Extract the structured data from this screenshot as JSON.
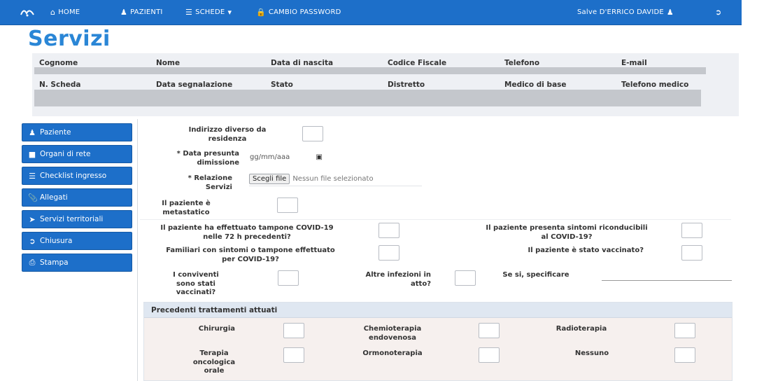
{
  "navbar": {
    "logo": "mg",
    "home": "HOME",
    "pazienti": "PAZIENTI",
    "schede": "SCHEDE",
    "cambio_password": "CAMBIO PASSWORD",
    "user_greeting": "Salve D'ERRICO DAVIDE"
  },
  "page": {
    "title": "Servizi"
  },
  "info": {
    "headers_row1": [
      "Cognome",
      "Nome",
      "Data di nascita",
      "Codice Fiscale",
      "Telefono",
      "E-mail"
    ],
    "headers_row2": [
      "N. Scheda",
      "Data segnalazione",
      "Stato",
      "Distretto",
      "Medico di base",
      "Telefono medico"
    ]
  },
  "sidebar": {
    "items": [
      {
        "label": "Paziente",
        "icon": "user-icon"
      },
      {
        "label": "Organi di rete",
        "icon": "building-icon"
      },
      {
        "label": "Checklist ingresso",
        "icon": "list-icon"
      },
      {
        "label": "Allegati",
        "icon": "paperclip-icon"
      },
      {
        "label": "Servizi territoriali",
        "icon": "arrow-right-icon"
      },
      {
        "label": "Chiusura",
        "icon": "sign-out-icon"
      },
      {
        "label": "Stampa",
        "icon": "print-icon"
      }
    ]
  },
  "form": {
    "indirizzo_label": "Indirizzo diverso da residenza",
    "data_dimissione_label": "* Data presunta dimissione",
    "data_dimissione_placeholder": "gg/mm/aaa",
    "relazione_label": "* Relazione Servizi",
    "file_button": "Scegli file",
    "file_status": "Nessun file selezionato",
    "metastatico_label": "Il paziente è metastatico",
    "tampone_label": "Il paziente ha effettuato tampone COVID-19 nelle 72 h precedenti?",
    "sintomi_label": "Il paziente presenta sintomi riconducibili al COVID-19?",
    "familiari_label": "Familiari con sintomi o tampone effettuato per COVID-19?",
    "vaccinato_label": "Il paziente è stato vaccinato?",
    "conviventi_label": "I conviventi sono stati vaccinati?",
    "altre_infezioni_label": "Altre infezioni in atto?",
    "specificare_label": "Se si, specificare"
  },
  "treatments": {
    "title": "Precedenti trattamenti attuati",
    "chirurgia": "Chirurgia",
    "chemioterapia": "Chemioterapia endovenosa",
    "radioterapia": "Radioterapia",
    "terapia_orale": "Terapia oncologica orale",
    "ormonoterapia": "Ormonoterapia",
    "nessuno": "Nessuno"
  },
  "colors": {
    "navbar": "#1d6fc9",
    "title": "#2a86d6",
    "sidebar_button": "#1d6fc9",
    "info_panel": "#eef0f4",
    "treat_panel": "#f6f0ee"
  }
}
